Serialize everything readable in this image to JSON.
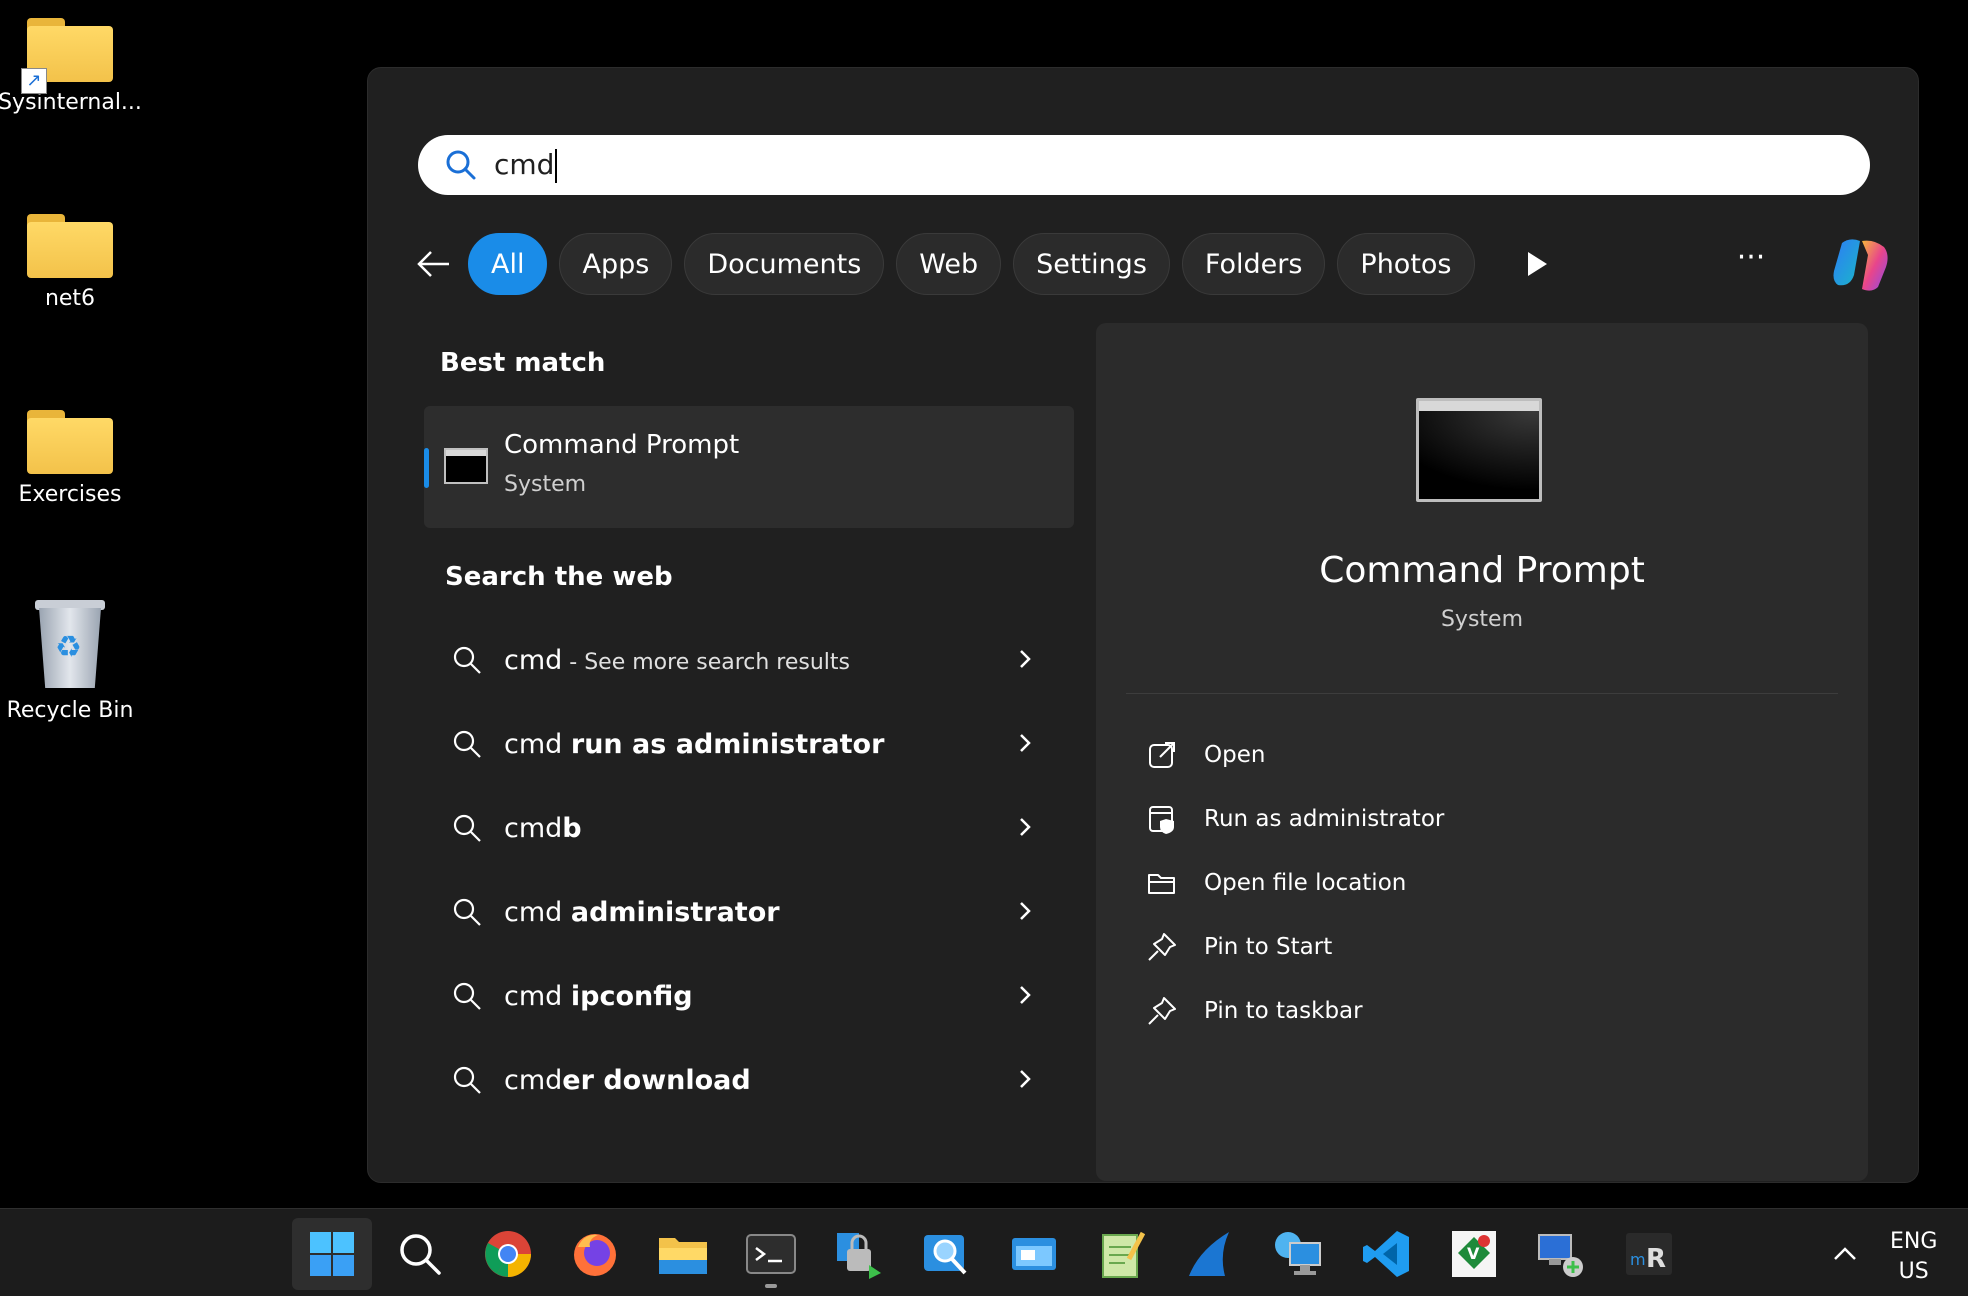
{
  "desktop": {
    "icons": [
      {
        "label": "Sysinternal...",
        "type": "folder-shortcut"
      },
      {
        "label": "net6",
        "type": "folder"
      },
      {
        "label": "Exercises",
        "type": "folder"
      },
      {
        "label": "Recycle Bin",
        "type": "recycle-bin"
      }
    ]
  },
  "search": {
    "query": "cmd",
    "icon": "search-icon"
  },
  "filters": {
    "items": [
      "All",
      "Apps",
      "Documents",
      "Web",
      "Settings",
      "Folders",
      "Photos"
    ],
    "active": "All"
  },
  "best_match": {
    "heading": "Best match",
    "title": "Command Prompt",
    "subtitle": "System"
  },
  "web": {
    "heading": "Search the web",
    "results": [
      {
        "prefix": "cmd",
        "bold": "",
        "hint": " - See more search results"
      },
      {
        "prefix": "cmd ",
        "bold": "run as administrator",
        "hint": ""
      },
      {
        "prefix": "cmd",
        "bold": "b",
        "hint": ""
      },
      {
        "prefix": "cmd ",
        "bold": "administrator",
        "hint": ""
      },
      {
        "prefix": "cmd ",
        "bold": "ipconfig",
        "hint": ""
      },
      {
        "prefix": "cmd",
        "bold": "er download",
        "hint": ""
      }
    ]
  },
  "details": {
    "title": "Command Prompt",
    "subtitle": "System",
    "actions": [
      "Open",
      "Run as administrator",
      "Open file location",
      "Pin to Start",
      "Pin to taskbar"
    ]
  },
  "taskbar": {
    "apps": [
      "start",
      "search",
      "chrome",
      "firefox",
      "file-explorer",
      "terminal",
      "security-tool",
      "magnifier-app",
      "window-app",
      "notepad",
      "wireshark",
      "remote-desktop",
      "vscode",
      "vim",
      "network-app",
      "mremoteng"
    ],
    "tray": {
      "lang_top": "ENG",
      "lang_bottom": "US"
    }
  },
  "colors": {
    "accent": "#1a8ce8",
    "panel": "#202020",
    "pane": "#2b2b2b"
  }
}
